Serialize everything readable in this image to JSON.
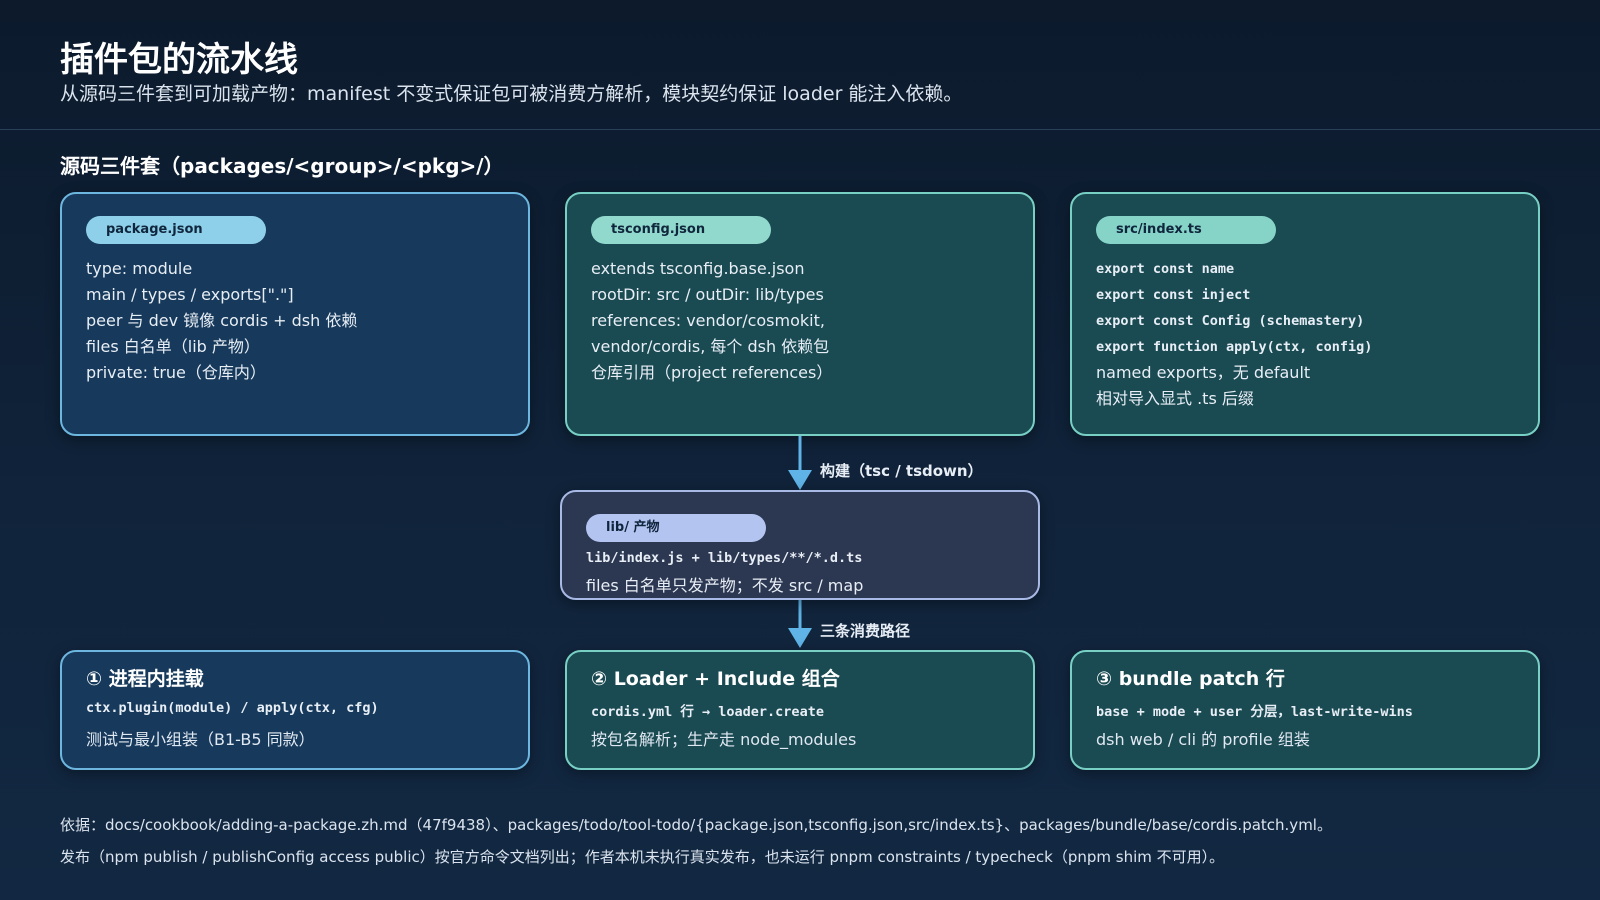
{
  "header": {
    "title": "插件包的流水线",
    "subtitle": "从源码三件套到可加载产物：manifest 不变式保证包可被消费方解析，模块契约保证 loader 能注入依赖。"
  },
  "section": {
    "title": "源码三件套（packages/<group>/<pkg>/）"
  },
  "source_cards": [
    {
      "label": "package.json",
      "lines": [
        "type: module",
        "main / types / exports[\".\"]",
        "peer 与 dev 镜像 cordis + dsh 依赖",
        "files 白名单（lib 产物）",
        "private: true（仓库内）"
      ]
    },
    {
      "label": "tsconfig.json",
      "lines": [
        "extends tsconfig.base.json",
        "rootDir: src / outDir: lib/types",
        "references: vendor/cosmokit,",
        "vendor/cordis, 每个 dsh 依赖包",
        "仓库引用（project references）"
      ]
    },
    {
      "label": "src/index.ts",
      "code_lines": [
        "export const name",
        "export const inject",
        "export const Config (schemastery)",
        "export function apply(ctx, config)"
      ],
      "lines": [
        "named exports，无 default",
        "相对导入显式 .ts 后缀"
      ]
    }
  ],
  "build_arrow_label": "构建（tsc / tsdown）",
  "lib_card": {
    "label": "lib/ 产物",
    "code": "lib/index.js + lib/types/**/*.d.ts",
    "desc": "files 白名单只发产物；不发 src / map"
  },
  "consume_arrow_label": "三条消费路径",
  "consumers": [
    {
      "title": "① 进程内挂载",
      "code": "ctx.plugin(module) / apply(ctx, cfg)",
      "desc": "测试与最小组装（B1-B5 同款）"
    },
    {
      "title": "② Loader + Include 组合",
      "code": "cordis.yml 行 → loader.create",
      "desc": "按包名解析；生产走 node_modules"
    },
    {
      "title": "③ bundle patch 行",
      "code": "base + mode + user 分层，last-write-wins",
      "desc": "dsh web / cli 的 profile 组装"
    }
  ],
  "footer": {
    "line1": "依据：docs/cookbook/adding-a-package.zh.md（47f9438）、packages/todo/tool-todo/{package.json,tsconfig.json,src/index.ts}、packages/bundle/base/cordis.patch.yml。",
    "line2": "发布（npm publish / publishConfig access public）按官方命令文档列出；作者本机未执行真实发布，也未运行 pnpm constraints / typecheck（pnpm shim 不可用）。"
  },
  "colors": {
    "background": "#0c1a2c",
    "card_blue": "#173a5c",
    "card_teal": "#1a4a52",
    "card_slate": "#2c3752",
    "arrow": "#5fb3e6"
  }
}
